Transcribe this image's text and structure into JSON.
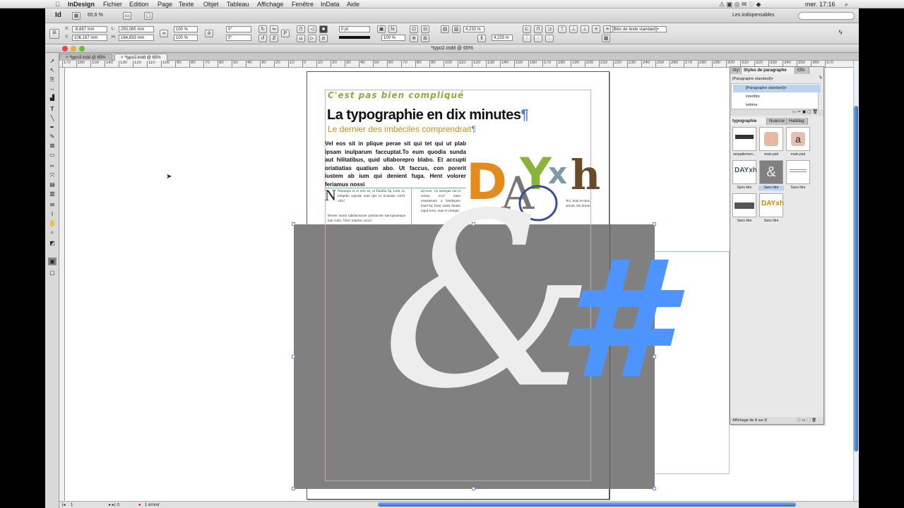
{
  "menubar": {
    "app": "InDesign",
    "items": [
      "Fichier",
      "Edition",
      "Page",
      "Texte",
      "Objet",
      "Tableau",
      "Affichage",
      "Fenêtre",
      "InData",
      "Aide"
    ],
    "clock": "mer. 17:16"
  },
  "appbar": {
    "logo": "Id",
    "zoom": "65,6 %",
    "workspace": "Les indispensables"
  },
  "controlbar": {
    "x_label": "X:",
    "x_value": "-8,667 mm",
    "y_label": "Y:",
    "y_value": "106,167 mm",
    "w_label": "L:",
    "w_value": "250,085 mm",
    "h_label": "H:",
    "h_value": "184,833 mm",
    "scale_x": "100 %",
    "scale_y": "100 %",
    "angle": "0°",
    "shear": "0°",
    "stroke_weight": "0 pt",
    "opacity": "100 %",
    "offset_1": "4,233 m",
    "offset_2": "4,233 m",
    "style_select": "[Bloc de texte standard]+"
  },
  "window": {
    "title": "*typo2.indd @ 65%",
    "tabs": [
      "*typo3.indd @ 65%",
      "*typo2.indd @ 65%"
    ]
  },
  "ruler": {
    "ticks": [
      "170",
      "160",
      "150",
      "140",
      "130",
      "120",
      "110",
      "100",
      "90",
      "80",
      "70",
      "60",
      "50",
      "40",
      "30",
      "20",
      "10",
      "0",
      "10",
      "20",
      "30",
      "40",
      "50",
      "60",
      "70",
      "80",
      "90",
      "100",
      "110",
      "120",
      "130",
      "140",
      "150",
      "160",
      "170",
      "180",
      "190",
      "200",
      "210",
      "220",
      "230",
      "240",
      "250",
      "260",
      "270",
      "280",
      "290",
      "300",
      "310",
      "320",
      "330",
      "340",
      "350",
      "360",
      "370"
    ]
  },
  "document": {
    "kicker": "C'est pas bien compliqué",
    "title": "La typographie en dix minutes",
    "subtitle": "Le dernier des imbéciles comprendrait",
    "lead": "Vel eos sit in plique perae sit qui tet qui ut plab ipsam inulparum faccuptat.To eum quodia sunda aut hilitatibus, quid ullaborepro blabo. Et accupti oriatiatias quatium abo. Ut faccus, con porerit iustem ab ium qui denient fuga. Hent volorer feriamus nossi",
    "col1": "Nonsequi re et erro eo, ut finullia Sp. Lem, et, nimpibu squoste num ipis in licatume corfic vilic!",
    "col1b": "Berem iurum labefactorum pubiincem hae-tipsumque hali vulin. Vilis! interfec uxira?",
    "col2": "ad sexe, vis semique cae et notius, eco? nuno resentenum a Sendepero hand fac facer audes fatiam ingul-toris, ocae re clempit.",
    "col3": "Aci, num re-mus, urnum, mo horior",
    "art": "DAYxh",
    "pilcrow": "¶"
  },
  "panel": {
    "tabs": [
      "Styl",
      "Styles de paragraphe",
      "Effe"
    ],
    "current": "[Paragraphe standard]+",
    "styles": [
      "[Paragraphe standard]+",
      "intertitre",
      "lettrine"
    ],
    "lib_tabs": [
      "typographie",
      "Nuancie",
      "Habillag"
    ],
    "thumbs": [
      "empattemen...",
      "main.psd",
      "main.psd",
      "Sans titre",
      "Sans titre",
      "Sans titre",
      "Sans titre",
      "Sans titre"
    ],
    "footer": "Affichage de 8 sur 8"
  },
  "status": {
    "page": "1",
    "errors": "1 erreur"
  },
  "colors": {
    "accent_blue": "#4d94ff",
    "grey_frame": "#808080",
    "kicker_green": "#8aac3a",
    "subtitle_orange": "#d18a12"
  }
}
